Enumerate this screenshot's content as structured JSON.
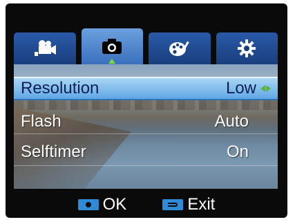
{
  "tabs": [
    {
      "icon": "movie-camera-icon",
      "active": false
    },
    {
      "icon": "camera-icon",
      "active": true
    },
    {
      "icon": "palette-icon",
      "active": false
    },
    {
      "icon": "gear-icon",
      "active": false
    }
  ],
  "menu": {
    "items": [
      {
        "label": "Resolution",
        "value": "Low",
        "selected": true
      },
      {
        "label": "Flash",
        "value": "Auto",
        "selected": false
      },
      {
        "label": "Selftimer",
        "value": "On",
        "selected": false
      }
    ]
  },
  "footer": {
    "ok_label": "OK",
    "exit_label": "Exit"
  },
  "colors": {
    "tab": "#183e7e",
    "tab_active": "#3c70bf",
    "selection": "#5fa7e4",
    "key": "#2f8bd6",
    "arrow": "#57b82a"
  }
}
